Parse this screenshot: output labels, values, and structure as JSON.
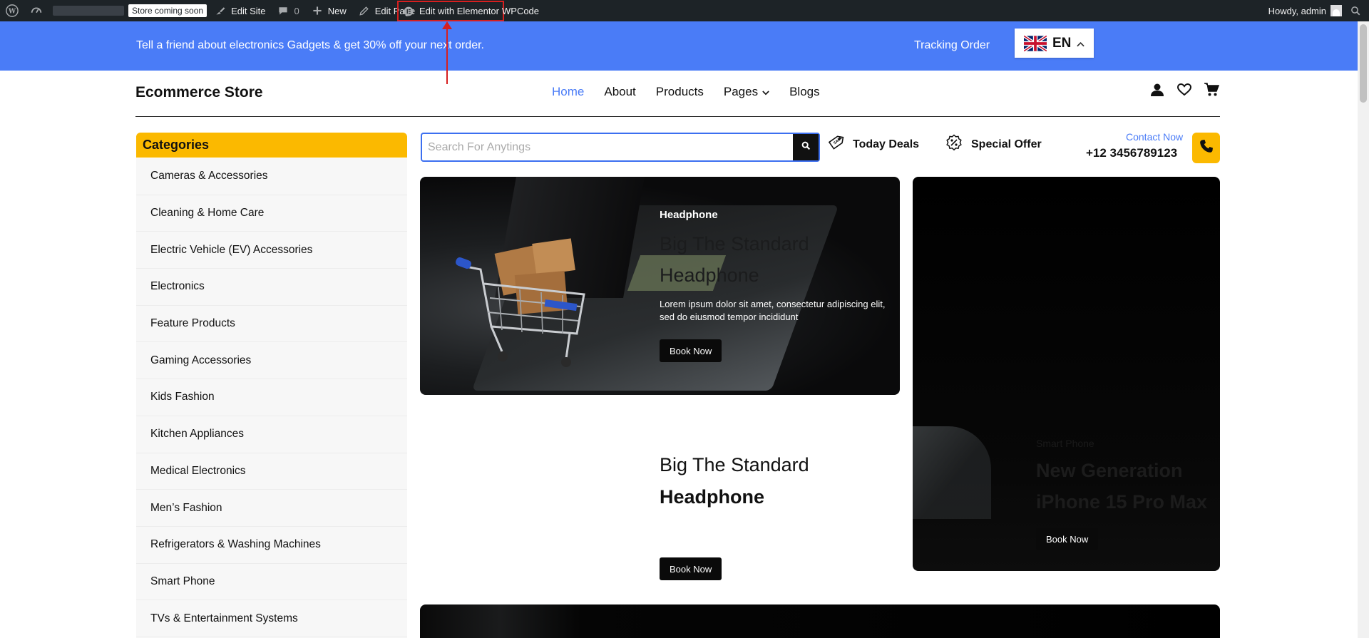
{
  "admin_bar": {
    "store_badge": "Store coming soon",
    "edit_site": "Edit Site",
    "comments_count": "0",
    "new": "New",
    "edit_page": "Edit Page",
    "edit_with_elementor": "Edit with Elementor",
    "wpcode": "WPCode",
    "howdy": "Howdy, admin"
  },
  "promo": {
    "text": "Tell a friend about electronics Gadgets & get 30% off your next order.",
    "tracking": "Tracking Order",
    "language": "EN"
  },
  "header": {
    "logo": "Ecommerce Store",
    "nav": [
      {
        "label": "Home",
        "active": true
      },
      {
        "label": "About"
      },
      {
        "label": "Products"
      },
      {
        "label": "Pages"
      },
      {
        "label": "Blogs"
      }
    ]
  },
  "sidebar": {
    "title": "Categories",
    "items": [
      "Cameras & Accessories",
      "Cleaning & Home Care",
      "Electric Vehicle (EV) Accessories",
      "Electronics",
      "Feature Products",
      "Gaming Accessories",
      "Kids Fashion",
      "Kitchen Appliances",
      "Medical Electronics",
      "Men’s Fashion",
      "Refrigerators & Washing Machines",
      "Smart Phone",
      "TVs & Entertainment Systems"
    ]
  },
  "search": {
    "placeholder": "Search For Anytings"
  },
  "deals": {
    "today": "Today Deals",
    "special": "Special Offer"
  },
  "contact": {
    "label": "Contact Now",
    "number": "+12 3456789123"
  },
  "banner1": {
    "subtitle": "Headphone",
    "title_line1": "Big The Standard",
    "title_line2": "Headphone",
    "description": "Lorem ipsum dolor sit amet, consectetur adipiscing elit, sed do eiusmod tempor incididunt",
    "button": "Book Now"
  },
  "banner2": {
    "title_line1": "Big The Standard",
    "title_line2": "Headphone",
    "button": "Book Now"
  },
  "banner3": {
    "subtitle": "Smart Phone",
    "title_line1": "New Generation",
    "title_line2": "iPhone 15 Pro Max",
    "button": "Book Now"
  },
  "colors": {
    "accent_blue": "#4a7cf7",
    "accent_yellow": "#fbb900",
    "admin_bar": "#1d2327",
    "annotation_red": "#d61f1f"
  }
}
